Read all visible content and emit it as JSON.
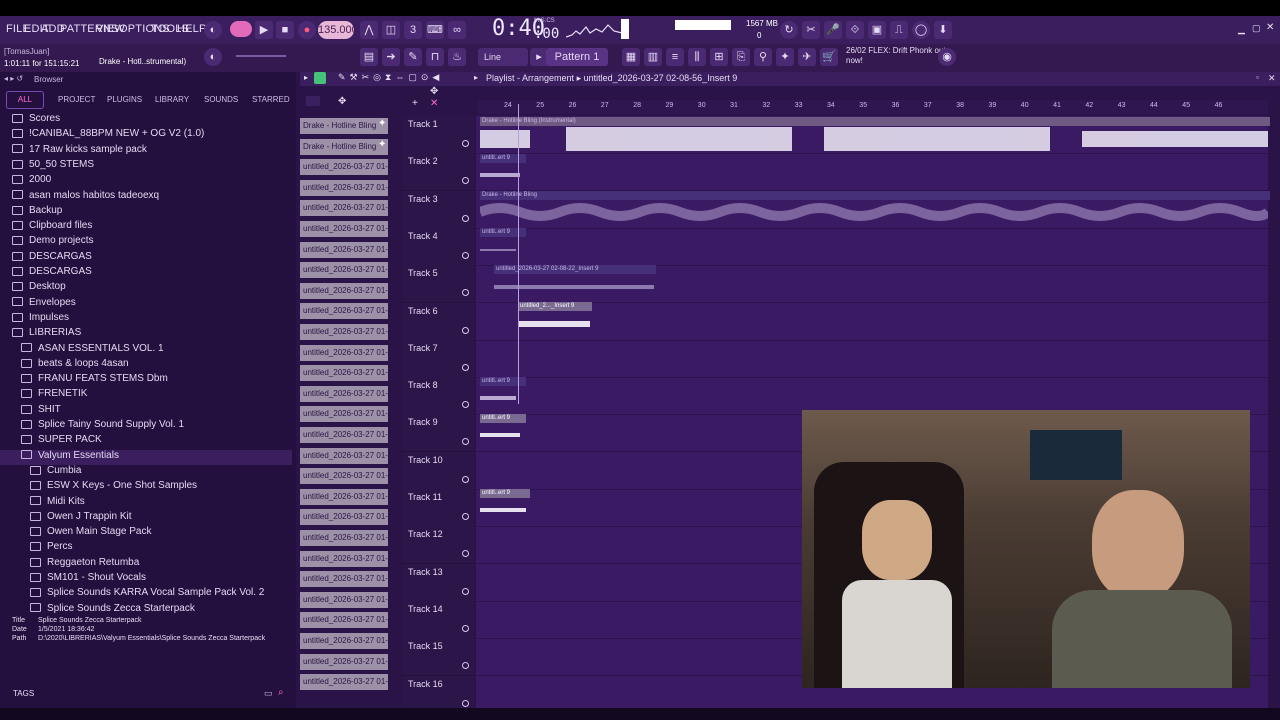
{
  "menu": [
    "FILE",
    "EDIT",
    "ADD",
    "PATTERNS",
    "VIEW",
    "OPTIONS",
    "TOOLS",
    "HELP"
  ],
  "transport": {
    "tempo": "135.000",
    "time": "0:40",
    "time_ms": ":00",
    "time_unit": "M:S:CS",
    "cpu_value": "44",
    "memory": "1567 MB",
    "memory_sub": "0"
  },
  "hint": {
    "user": "[TomasJuan]",
    "position": "1:01:11 for 151:15:21",
    "song": "Drake - Hotl..strumental)"
  },
  "toolbar": {
    "snap": "Line",
    "pattern": "Pattern 1",
    "news_date": "26/02",
    "news_text": "FLEX: Drift Phonk out now!"
  },
  "browser": {
    "title": "Browser",
    "tabs": [
      "ALL",
      "PROJECT",
      "PLUGINS",
      "LIBRARY",
      "SOUNDS",
      "STARRED"
    ],
    "items": [
      {
        "label": "Scores",
        "depth": 0
      },
      {
        "label": "!CANIBAL_88BPM NEW + OG V2 (1.0)",
        "depth": 0
      },
      {
        "label": "17 Raw kicks sample pack",
        "depth": 0
      },
      {
        "label": "50_50 STEMS",
        "depth": 0
      },
      {
        "label": "2000",
        "depth": 0
      },
      {
        "label": "asan malos habitos tadeoexq",
        "depth": 0
      },
      {
        "label": "Backup",
        "depth": 0
      },
      {
        "label": "Clipboard files",
        "depth": 0
      },
      {
        "label": "Demo projects",
        "depth": 0
      },
      {
        "label": "DESCARGAS",
        "depth": 0
      },
      {
        "label": "DESCARGAS",
        "depth": 0
      },
      {
        "label": "Desktop",
        "depth": 0
      },
      {
        "label": "Envelopes",
        "depth": 0
      },
      {
        "label": "Impulses",
        "depth": 0
      },
      {
        "label": "LIBRERIAS",
        "depth": 0
      },
      {
        "label": "ASAN ESSENTIALS VOL. 1",
        "depth": 1
      },
      {
        "label": "beats & loops 4asan",
        "depth": 1
      },
      {
        "label": "FRANU FEATS STEMS Dbm",
        "depth": 1
      },
      {
        "label": "FRENETIK",
        "depth": 1
      },
      {
        "label": "SHIT",
        "depth": 1
      },
      {
        "label": "Splice Tainy Sound Supply Vol. 1",
        "depth": 1
      },
      {
        "label": "SUPER PACK",
        "depth": 1
      },
      {
        "label": "Valyum Essentials",
        "depth": 1
      },
      {
        "label": "Cumbia",
        "depth": 2
      },
      {
        "label": "ESW X Keys - One Shot Samples",
        "depth": 2
      },
      {
        "label": "Midi Kits",
        "depth": 2
      },
      {
        "label": "Owen J Trappin Kit",
        "depth": 2
      },
      {
        "label": "Owen Main Stage Pack",
        "depth": 2
      },
      {
        "label": "Percs",
        "depth": 2
      },
      {
        "label": "Reggaeton Retumba",
        "depth": 2
      },
      {
        "label": "SM101 - Shout Vocals",
        "depth": 2
      },
      {
        "label": "Splice Sounds KARRA Vocal Sample Pack Vol. 2",
        "depth": 2
      },
      {
        "label": "Splice Sounds Zecca Starterpack",
        "depth": 2
      }
    ],
    "info": {
      "title_label": "Title",
      "title": "Splice Sounds Zecca Starterpack",
      "date_label": "Date",
      "date": "1/5/2021 18:36:42",
      "path_label": "Path",
      "path": "D:\\2020\\LIBRERIAS\\Valyum Essentials\\Splice Sounds Zecca Starterpack"
    },
    "tags": "TAGS"
  },
  "channels": [
    "Drake - Hotline Bling",
    "Drake - Hotline Bling",
    "untitled_2026-03-27 01-",
    "untitled_2026-03-27 01-",
    "untitled_2026-03-27 01-",
    "untitled_2026-03-27 01-",
    "untitled_2026-03-27 01-",
    "untitled_2026-03-27 01-",
    "untitled_2026-03-27 01-",
    "untitled_2026-03-27 01-",
    "untitled_2026-03-27 01-",
    "untitled_2026-03-27 01-",
    "untitled_2026-03-27 01-",
    "untitled_2026-03-27 01-",
    "untitled_2026-03-27 01-",
    "untitled_2026-03-27 01-",
    "untitled_2026-03-27 01-",
    "untitled_2026-03-27 01-",
    "untitled_2026-03-27 01-",
    "untitled_2026-03-27 01-",
    "untitled_2026-03-27 01-",
    "untitled_2026-03-27 01-",
    "untitled_2026-03-27 01-",
    "untitled_2026-03-27 01-",
    "untitled_2026-03-27 01-",
    "untitled_2026-03-27 01-",
    "untitled_2026-03-27 01-",
    "untitled_2026-03-27 01-"
  ],
  "playlist": {
    "title": "Playlist - Arrangement",
    "project": "untitled_2026-03-27 02-08-56_Insert 9",
    "ticks": [
      "24",
      "25",
      "26",
      "27",
      "28",
      "29",
      "30",
      "31",
      "32",
      "33",
      "34",
      "35",
      "36",
      "37",
      "38",
      "39",
      "40",
      "41",
      "42",
      "43",
      "44",
      "45",
      "46"
    ],
    "tracks": [
      "Track 1",
      "Track 2",
      "Track 3",
      "Track 4",
      "Track 5",
      "Track 6",
      "Track 7",
      "Track 8",
      "Track 9",
      "Track 10",
      "Track 11",
      "Track 12",
      "Track 13",
      "Track 14",
      "Track 15",
      "Track 16"
    ],
    "clips": {
      "t1": "Drake - Hotline Bling (Instrumental)",
      "t2": "untitl..ert 9",
      "t3": "Drake - Hotline Bling",
      "t4": "untitl..ert 9",
      "t5": "untitled_2026-03-27 02-08-22_Insert 9",
      "t6": "untitled_2..._Insert 9",
      "t8": "untitl..ert 9",
      "t9": "untitl..ert 9",
      "t11": "untitl..ert 9"
    }
  },
  "colors": {
    "accent": "#ff6ad5",
    "background": "#2a1447",
    "lane": "#3a1a63",
    "clip_label": "#9d91a7"
  }
}
